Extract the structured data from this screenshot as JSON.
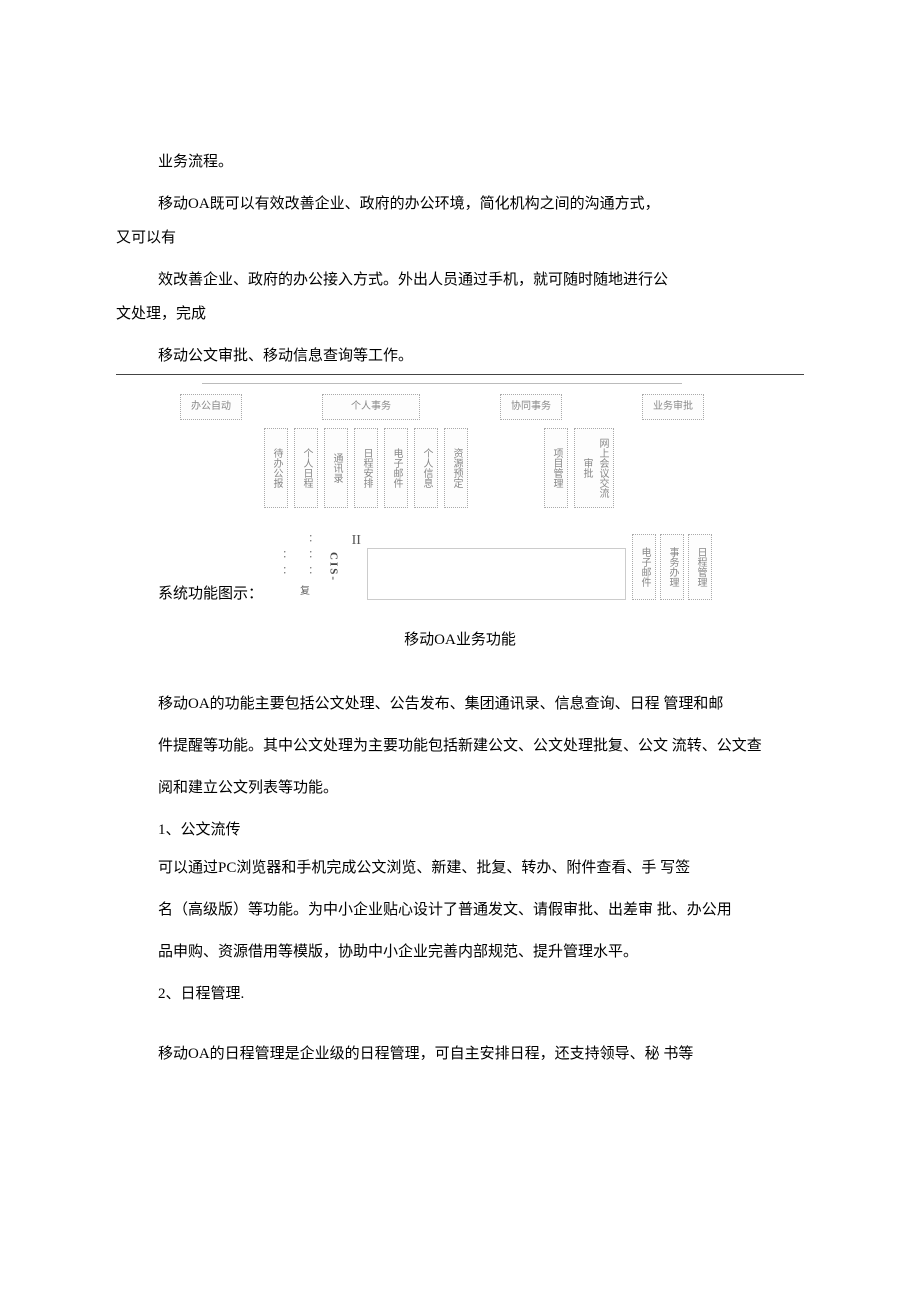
{
  "p1": "业务流程。",
  "p2": "移动OA既可以有效改善企业、政府的办公环境，简化机构之间的沟通方式，",
  "p2b": "又可以有",
  "p3": "效改善企业、政府的办公接入方式。外出人员通过手机，就可随时随地进行公",
  "p3b": "文处理，完成",
  "p4": "移动公文审批、移动信息查询等工作。",
  "diagram": {
    "top": [
      "办公自动",
      "个人事务",
      "协同事务",
      "业务审批"
    ],
    "mid_left": [
      "待办公报",
      "个人日程",
      "通讯录",
      "日程安排",
      "电子邮件",
      "个人信息",
      "资源预定"
    ],
    "mid_right": [
      "项目管理",
      "网上会议交流审批"
    ],
    "below": {
      "dots1": "：：",
      "dots2": "：：：",
      "cis": "CIS-",
      "fu": "复",
      "ii": "II",
      "v_right": [
        "电子邮件",
        "事务办理",
        "日程管理"
      ]
    }
  },
  "caption": "系统功能图示：",
  "title": "移动OA业务功能",
  "p5": "移动OA的功能主要包括公文处理、公告发布、集团通讯录、信息查询、日程 管理和邮",
  "p6": "件提醒等功能。其中公文处理为主要功能包括新建公文、公文处理批复、公文 流转、公文查",
  "p7": "阅和建立公文列表等功能。",
  "sec1": "1、公文流传",
  "p8": "可以通过PC浏览器和手机完成公文浏览、新建、批复、转办、附件查看、手 写签",
  "p9": "名（高级版）等功能。为中小企业贴心设计了普通发文、请假审批、出差审 批、办公用",
  "p10": "品申购、资源借用等模版，协助中小企业完善内部规范、提升管理水平。",
  "sec2": "2、日程管理.",
  "p11": "移动OA的日程管理是企业级的日程管理，可自主安排日程，还支持领导、秘 书等"
}
